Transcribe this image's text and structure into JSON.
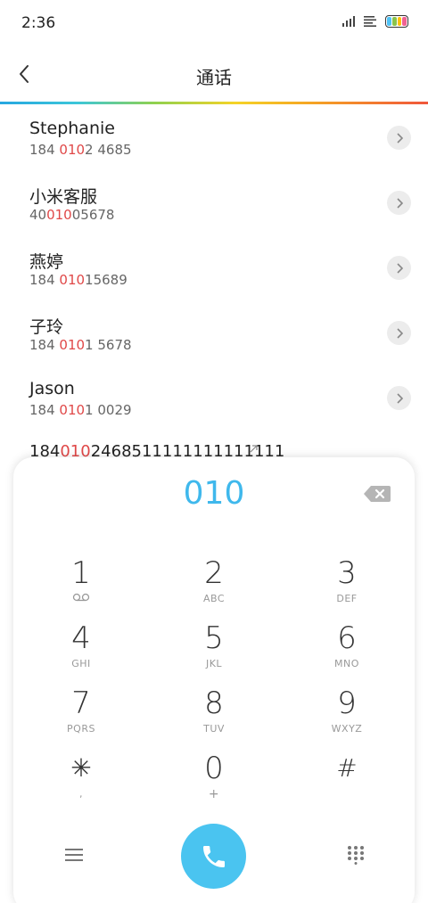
{
  "status_bar": {
    "time": "2:36",
    "battery_colors": [
      "#4fc3f7",
      "#8bc34a",
      "#ffc107",
      "#f06292"
    ]
  },
  "app_bar": {
    "back_icon": "chevron-left-icon",
    "title": "通话"
  },
  "contacts": [
    {
      "name": "Stephanie",
      "number_before": "184 ",
      "number_match": "010",
      "number_after": "2 4685"
    },
    {
      "name": "小米客服",
      "number_before": "40",
      "number_match": "010",
      "number_after": "05678"
    },
    {
      "name": "燕婷",
      "number_before": "184 ",
      "number_match": "010",
      "number_after": "15689"
    },
    {
      "name": "子玲",
      "number_before": "184 ",
      "number_match": "010",
      "number_after": "1 5678"
    },
    {
      "name": "Jason",
      "number_before": "184 ",
      "number_match": "010",
      "number_after": "1 0029"
    }
  ],
  "partial_entry": {
    "number_before": "184",
    "number_match": "010",
    "number_after": "2468511111111111111"
  },
  "dialpad": {
    "input_value": "010",
    "keys": [
      {
        "digit": "1",
        "sub": "",
        "sub_icon": "voicemail-icon"
      },
      {
        "digit": "2",
        "sub": "ABC"
      },
      {
        "digit": "3",
        "sub": "DEF"
      },
      {
        "digit": "4",
        "sub": "GHI"
      },
      {
        "digit": "5",
        "sub": "JKL"
      },
      {
        "digit": "6",
        "sub": "MNO"
      },
      {
        "digit": "7",
        "sub": "PQRS"
      },
      {
        "digit": "8",
        "sub": "TUV"
      },
      {
        "digit": "9",
        "sub": "WXYZ"
      },
      {
        "digit": "✳",
        "sub": ","
      },
      {
        "digit": "0",
        "sub": "+"
      },
      {
        "digit": "#",
        "sub": ""
      }
    ],
    "accent_color": "#4ac4f0",
    "highlight_color": "#e04848"
  }
}
